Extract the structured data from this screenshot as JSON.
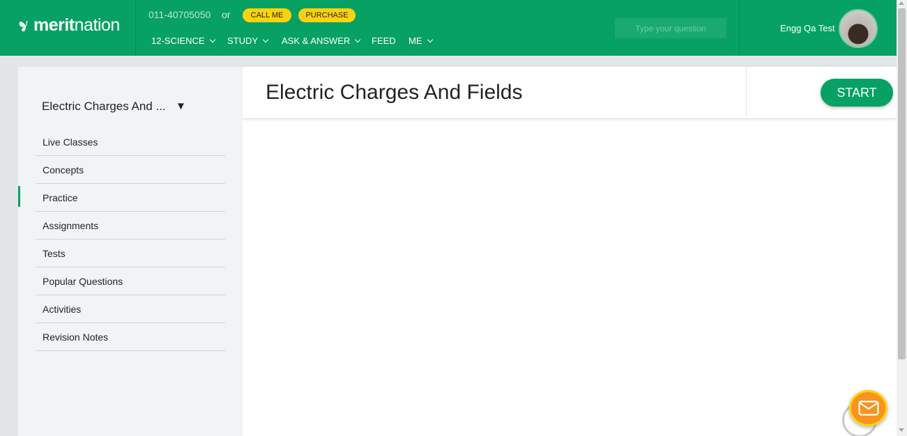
{
  "header": {
    "logo": "meritnation",
    "phone": "011-40705050",
    "or_text": "or",
    "call_me": "CALL ME",
    "purchase": "PURCHASE",
    "nav": [
      "12-SCIENCE",
      "STUDY",
      "ASK & ANSWER",
      "FEED",
      "ME"
    ],
    "question_placeholder": "Type your question",
    "username": "Engg Qa Test"
  },
  "sidebar": {
    "chapter": "Electric Charges And ...",
    "items": [
      "Live Classes",
      "Concepts",
      "Practice",
      "Assignments",
      "Tests",
      "Popular Questions",
      "Activities",
      "Revision Notes"
    ],
    "active_item": "Practice"
  },
  "main": {
    "title": "Electric Charges And Fields",
    "start_label": "START"
  },
  "colors": {
    "brand": "#07a163",
    "accent": "#fcd20e",
    "mail": "#f7931e"
  }
}
